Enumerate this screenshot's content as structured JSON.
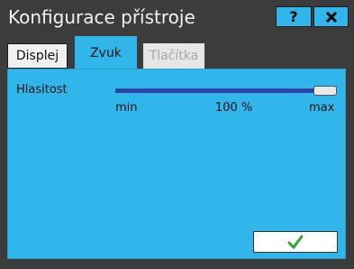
{
  "window": {
    "title": "Konfigurace přístroje",
    "help_label": "?",
    "close_icon": "close-x-icon"
  },
  "tabs": [
    {
      "label": "Displej",
      "state": "normal"
    },
    {
      "label": "Zvuk",
      "state": "active"
    },
    {
      "label": "Tlačítka",
      "state": "disabled"
    }
  ],
  "volume": {
    "label": "Hlasitost",
    "value_text": "100 %",
    "value_percent": 100,
    "min_label": "min",
    "max_label": "max"
  },
  "ok_button": {
    "icon": "checkmark-icon",
    "icon_color": "#2ea82e"
  },
  "colors": {
    "accent": "#30b6ea",
    "frame": "#3c3c3c",
    "slider_track": "#2f2f8a"
  }
}
